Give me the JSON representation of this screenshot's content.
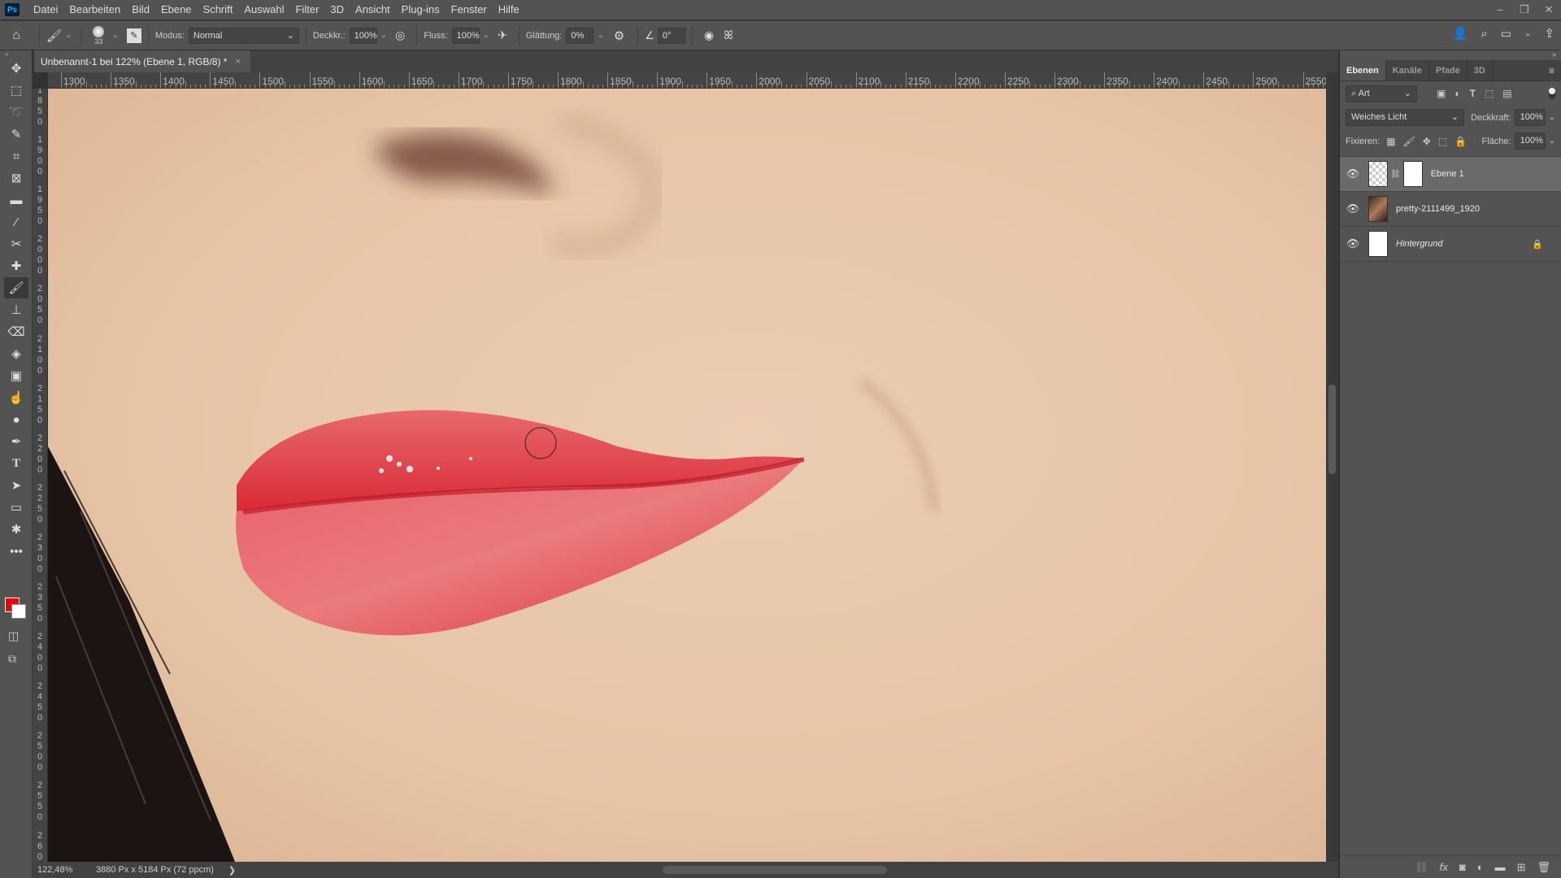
{
  "app": {
    "logo": "Ps"
  },
  "menu": [
    "Datei",
    "Bearbeiten",
    "Bild",
    "Ebene",
    "Schrift",
    "Auswahl",
    "Filter",
    "3D",
    "Ansicht",
    "Plug-ins",
    "Fenster",
    "Hilfe"
  ],
  "window_controls": {
    "minimize": "–",
    "restore": "❐",
    "close": "✕"
  },
  "options": {
    "brush_size": "33",
    "mode_label": "Modus:",
    "mode_value": "Normal",
    "opacity_label": "Deckkr.:",
    "opacity_value": "100%",
    "flow_label": "Fluss:",
    "flow_value": "100%",
    "smoothing_label": "Glättung:",
    "smoothing_value": "0%",
    "angle_value": "0°"
  },
  "document_tab": {
    "title": "Unbenannt-1 bei 122% (Ebene 1, RGB/8) *",
    "close": "×"
  },
  "rulers": {
    "horizontal": [
      "1300",
      "1350",
      "1400",
      "1450",
      "1500",
      "1550",
      "1600",
      "1650",
      "1700",
      "1750",
      "1800",
      "1850",
      "1900",
      "1950",
      "2000",
      "2050",
      "2100",
      "2150",
      "2200",
      "2250",
      "2300",
      "2350",
      "2400",
      "2450",
      "2500",
      "2550"
    ],
    "vertical": [
      "1850",
      "1900",
      "1950",
      "2000",
      "2050",
      "2100",
      "2150",
      "2200",
      "2250",
      "2300",
      "2350",
      "2400",
      "2450",
      "2500",
      "2550",
      "2600"
    ]
  },
  "colors": {
    "foreground": "#e8000c",
    "background": "#ffffff",
    "lip": "#e2404a",
    "skin": "#e6c5a8"
  },
  "status": {
    "zoom": "122,48%",
    "doc_info": "3880 Px x 5184 Px (72 ppcm)",
    "arrow": "❯"
  },
  "panel": {
    "tabs": [
      "Ebenen",
      "Kanäle",
      "Pfade",
      "3D"
    ],
    "active_tab": "Ebenen",
    "filter_label": "Art",
    "blend_mode": "Weiches Licht",
    "opacity_label": "Deckkraft:",
    "opacity_value": "100%",
    "lock_label": "Fixieren:",
    "fill_label": "Fläche:",
    "fill_value": "100%",
    "layers": [
      {
        "name": "Ebene 1",
        "selected": true
      },
      {
        "name": "pretty-2111499_1920",
        "selected": false
      },
      {
        "name": "Hintergrund",
        "selected": false,
        "locked": true
      }
    ]
  }
}
